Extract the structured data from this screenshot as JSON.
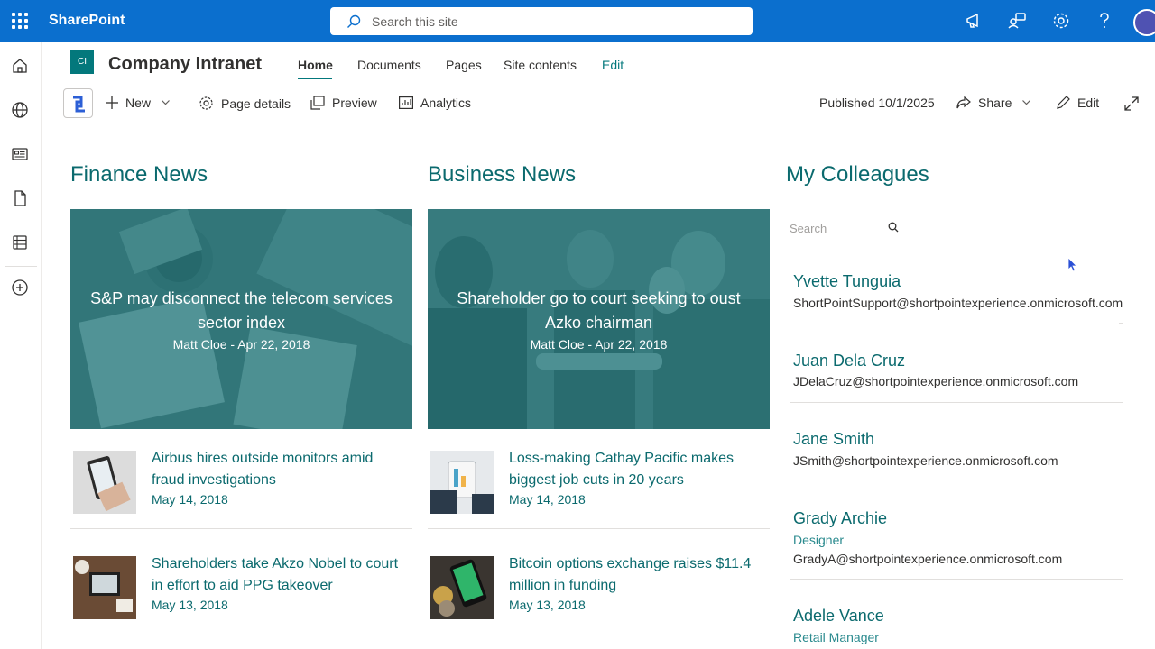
{
  "suite": {
    "app_name": "SharePoint",
    "search_placeholder": "Search this site"
  },
  "site": {
    "logo_text": "CI",
    "name": "Company Intranet",
    "nav": [
      {
        "label": "Home",
        "active": true
      },
      {
        "label": "Documents"
      },
      {
        "label": "Pages"
      },
      {
        "label": "Site contents"
      },
      {
        "label": "Edit"
      }
    ]
  },
  "commandbar": {
    "new": "New",
    "page_details": "Page details",
    "preview": "Preview",
    "analytics": "Analytics",
    "published": "Published 10/1/2025",
    "share": "Share",
    "edit": "Edit"
  },
  "finance": {
    "title": "Finance News",
    "hero": {
      "title": "S&P may disconnect the telecom services sector index",
      "meta": "Matt Cloe - Apr 22, 2018"
    },
    "items": [
      {
        "title": "Airbus hires outside monitors amid fraud investigations",
        "date": "May 14, 2018"
      },
      {
        "title": "Shareholders take Akzo Nobel to court in effort to aid PPG takeover",
        "date": "May 13, 2018"
      }
    ]
  },
  "business": {
    "title": "Business News",
    "hero": {
      "title": "Shareholder go to court seeking to oust Azko chairman",
      "meta": "Matt Cloe - Apr 22, 2018"
    },
    "items": [
      {
        "title": "Loss-making Cathay Pacific makes biggest job cuts in 20 years",
        "date": "May 14, 2018"
      },
      {
        "title": "Bitcoin options exchange raises $11.4 million in funding",
        "date": "May 13, 2018"
      }
    ]
  },
  "colleagues": {
    "title": "My Colleagues",
    "search_placeholder": "Search",
    "people": [
      {
        "name": "Yvette Tunguia",
        "email": "ShortPointSupport@shortpointexperience.onmicrosoft.com"
      },
      {
        "name": "Juan Dela Cruz",
        "email": "JDelaCruz@shortpointexperience.onmicrosoft.com"
      },
      {
        "name": "Jane Smith",
        "email": "JSmith@shortpointexperience.onmicrosoft.com"
      },
      {
        "name": "Grady Archie",
        "role": "Designer",
        "email": "GradyA@shortpointexperience.onmicrosoft.com"
      },
      {
        "name": "Adele Vance",
        "role": "Retail Manager"
      }
    ]
  }
}
